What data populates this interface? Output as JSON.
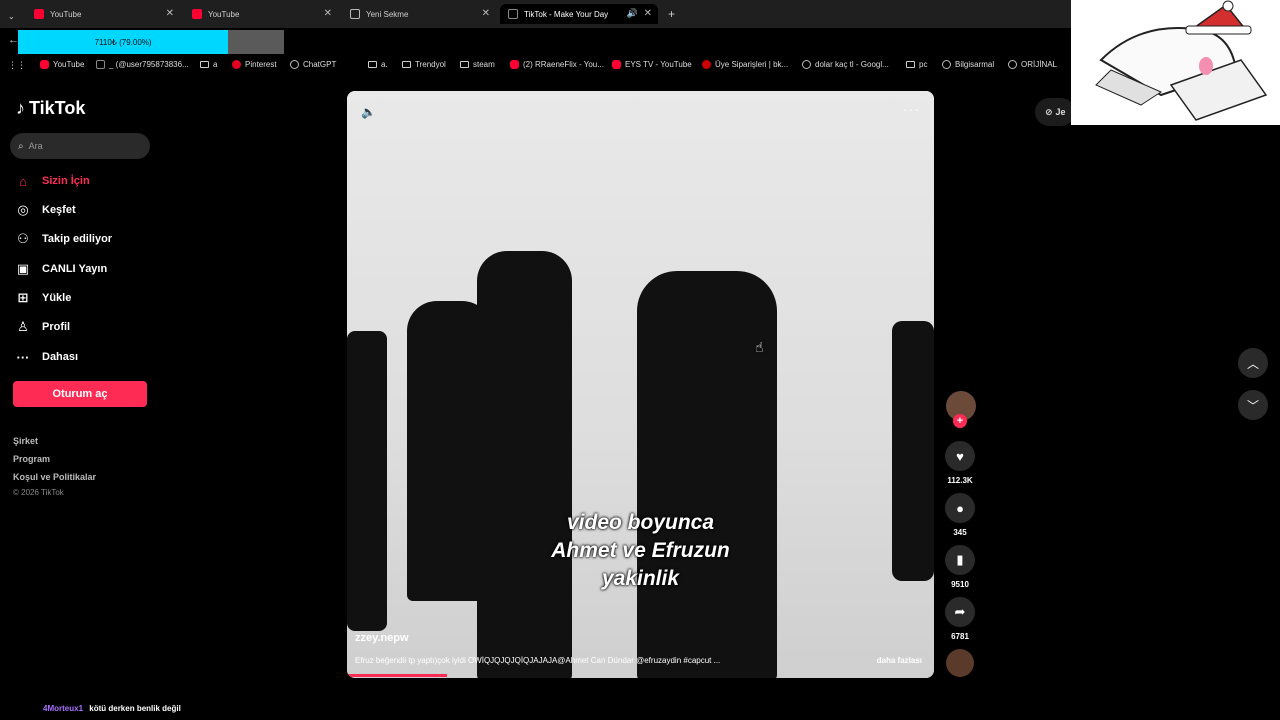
{
  "browser": {
    "tabs": [
      {
        "label": "YouTube",
        "icon": "youtube-icon"
      },
      {
        "label": "YouTube",
        "icon": "youtube-icon"
      },
      {
        "label": "Yeni Sekme",
        "icon": "globe-icon"
      },
      {
        "label": "TikTok - Make Your Day",
        "icon": "tiktok-icon"
      }
    ],
    "new_tab": "+",
    "progress_text": "7110₺ (79.00%)",
    "progress_fraction": 0.79,
    "bookmarks": [
      {
        "label": "YouTube"
      },
      {
        "label": "_ (@user795873836..."
      },
      {
        "label": "a"
      },
      {
        "label": "Pinterest"
      },
      {
        "label": "ChatGPT"
      },
      {
        "label": "a."
      },
      {
        "label": "Trendyol"
      },
      {
        "label": "steam"
      },
      {
        "label": "(2) RRaeneFlix - You..."
      },
      {
        "label": "EYS TV - YouTube"
      },
      {
        "label": "Üye Siparişleri | bk..."
      },
      {
        "label": "dolar kaç tl - Googl..."
      },
      {
        "label": "pc"
      },
      {
        "label": "Bilgisarmal"
      },
      {
        "label": "ORİJİNAL"
      }
    ],
    "bookmarks_more": "»"
  },
  "sidebar": {
    "logo": "TikTok",
    "search_placeholder": "Ara",
    "items": [
      {
        "label": "Sizin İçin",
        "icon": "home-icon"
      },
      {
        "label": "Keşfet",
        "icon": "compass-icon"
      },
      {
        "label": "Takip ediliyor",
        "icon": "user-follow-icon"
      },
      {
        "label": "CANLI Yayın",
        "icon": "live-icon"
      },
      {
        "label": "Yükle",
        "icon": "upload-icon"
      },
      {
        "label": "Profil",
        "icon": "profile-icon"
      },
      {
        "label": "Dahası",
        "icon": "more-icon"
      }
    ],
    "login": "Oturum aç",
    "footer": [
      "Şirket",
      "Program",
      "Koşul ve Politikalar"
    ],
    "copyright": "© 2026 TikTok"
  },
  "video": {
    "caption_lines": [
      "video boyunca",
      "Ahmet ve Efruzun",
      "yakinlik"
    ],
    "author": "zzey.nepw",
    "description": "Efruz beğendii tp yaptı)çok iyidi OWİQJQJQJQİQJAJAJA@Ahmet Can Dündar @efruzaydin #capcut ...",
    "see_more": "daha fazlası",
    "playback_fraction": 0.17
  },
  "actions": {
    "likes": "112.3K",
    "comments": "345",
    "saves": "9510",
    "shares": "6781"
  },
  "get_app": "Je",
  "chat": {
    "user": "4Morteux1",
    "message": "kötü derken benlik değil"
  },
  "colors": {
    "accent": "#fe2c55",
    "progress": "#00d7ff"
  }
}
